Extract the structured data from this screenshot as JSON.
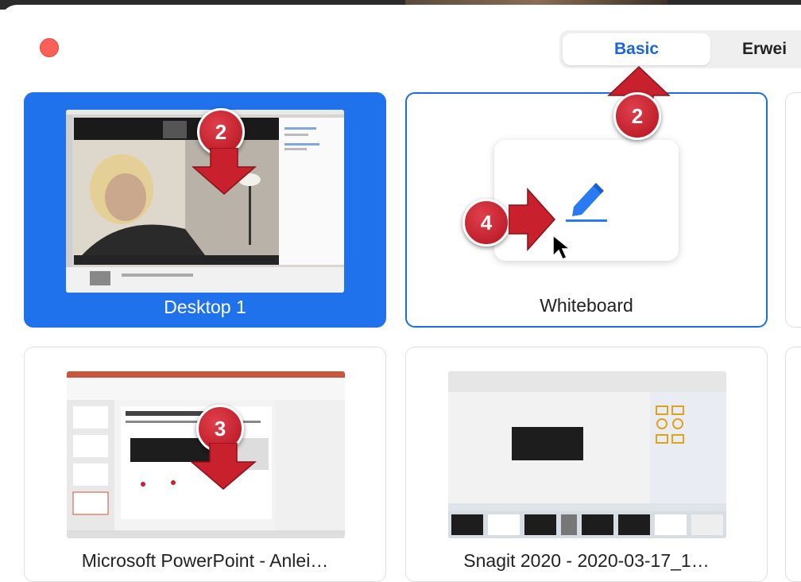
{
  "window": {
    "close_button": "close"
  },
  "segmented": {
    "tabs": [
      {
        "label": "Basic",
        "active": true
      },
      {
        "label": "Erwei",
        "active": false
      }
    ]
  },
  "tiles": [
    {
      "label": "Desktop 1",
      "state": "selected"
    },
    {
      "label": "Whiteboard",
      "state": "hover"
    },
    {
      "label": "Microsoft PowerPoint - Anlei…",
      "state": "normal"
    },
    {
      "label": "Snagit 2020 - 2020-03-17_1…",
      "state": "normal"
    }
  ],
  "annotations": {
    "badge_tile1": "2",
    "badge_tab": "2",
    "badge_whiteboard": "4",
    "badge_ppt": "3"
  },
  "colors": {
    "accent": "#1f72eb",
    "close": "#fe5f57",
    "annotation": "#c8202d"
  },
  "icons": {
    "whiteboard": "pen-icon",
    "cursor": "mouse-pointer-icon"
  }
}
